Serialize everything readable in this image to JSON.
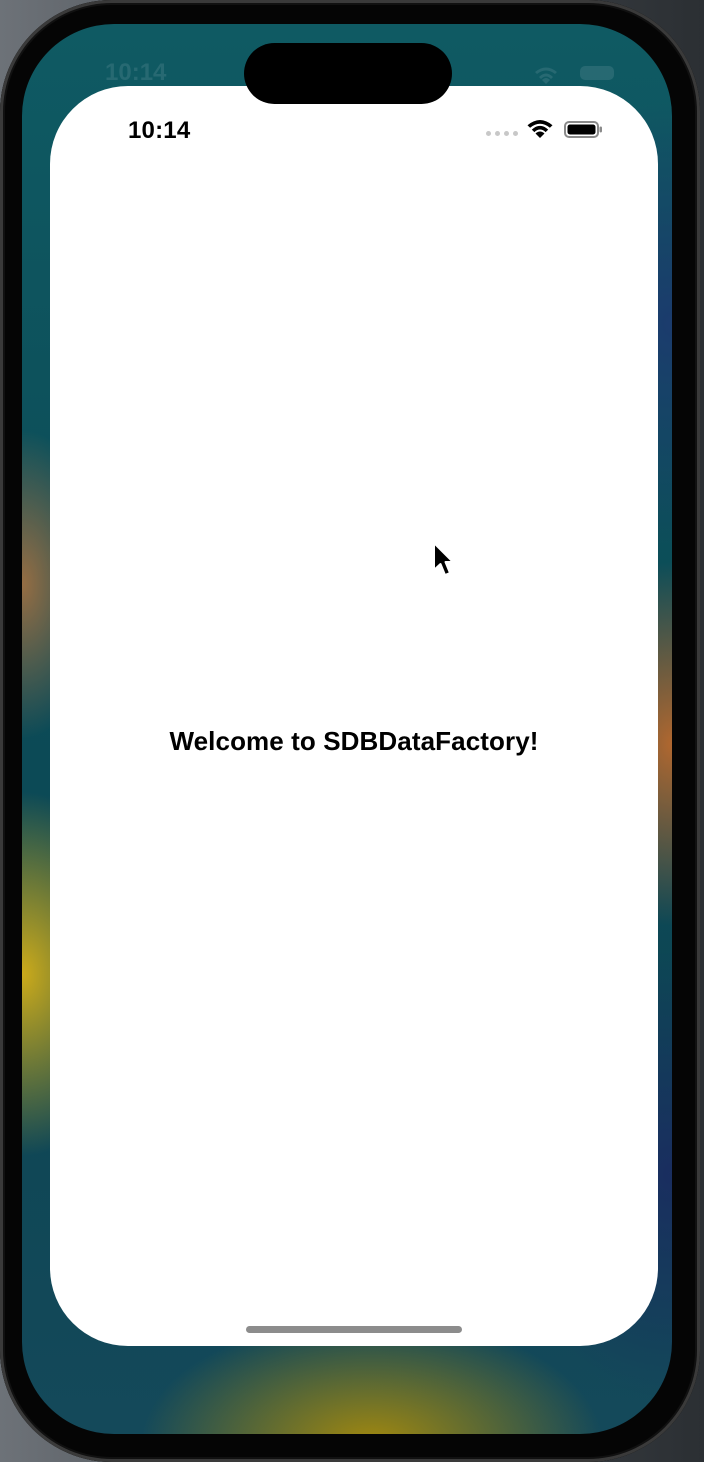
{
  "status_bar": {
    "time": "10:14",
    "icons": [
      "signal-dots-icon",
      "wifi-icon",
      "battery-icon"
    ]
  },
  "background_status_bar": {
    "time": "10:14",
    "icons": [
      "wifi-icon",
      "battery-icon"
    ]
  },
  "main": {
    "welcome_text": "Welcome to SDBDataFactory!"
  },
  "cursor": {
    "icon": "arrow-cursor-icon"
  },
  "colors": {
    "app_background": "#ffffff",
    "text": "#000000",
    "home_indicator": "#8c8c8c",
    "device_frame": "#050505"
  }
}
